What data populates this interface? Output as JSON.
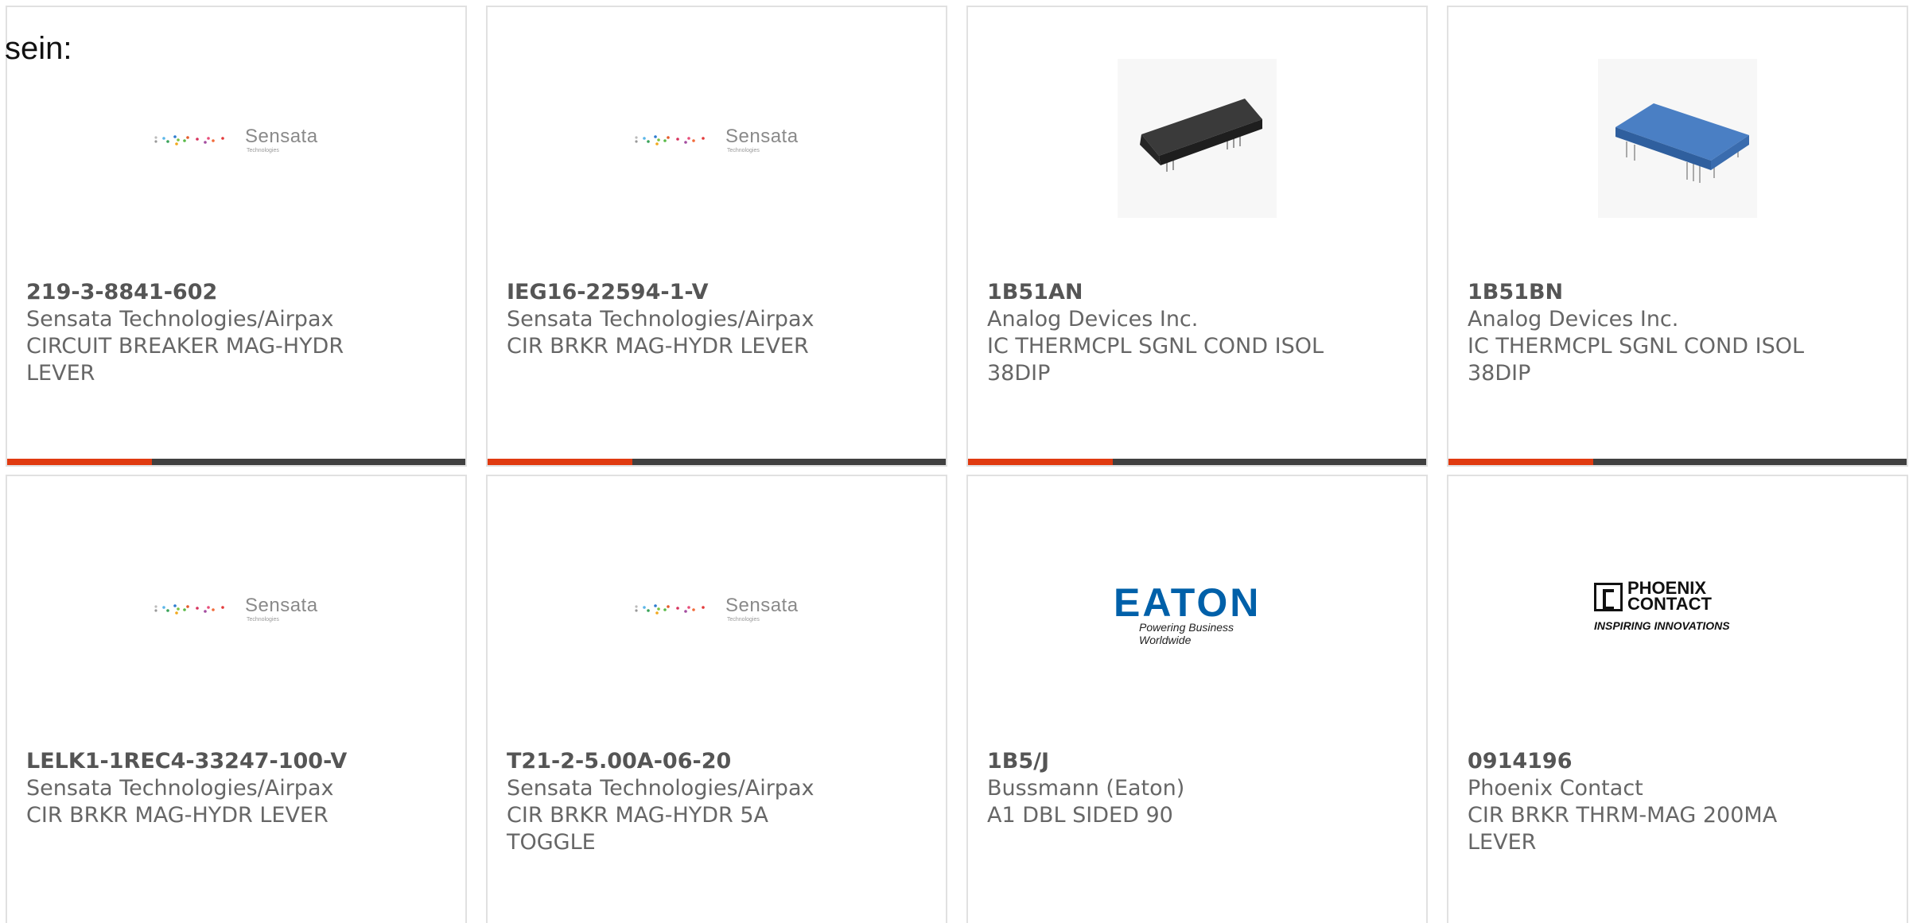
{
  "intro": {
    "text": "sein:"
  },
  "products": [
    {
      "part_number": "219-3-8841-602",
      "manufacturer": "Sensata Technologies/Airpax",
      "description": "CIRCUIT BREAKER MAG-HYDR LEVER",
      "image": "sensata-logo",
      "logo_text": "Sensata",
      "logo_subtext": "Technologies"
    },
    {
      "part_number": "IEG16-22594-1-V",
      "manufacturer": "Sensata Technologies/Airpax",
      "description": "CIR BRKR MAG-HYDR LEVER",
      "image": "sensata-logo",
      "logo_text": "Sensata",
      "logo_subtext": "Technologies"
    },
    {
      "part_number": "1B51AN",
      "manufacturer": "Analog Devices Inc.",
      "description": "IC THERMCPL SGNL COND ISOL 38DIP",
      "image": "black-dip-module",
      "color": "#2a2a2a"
    },
    {
      "part_number": "1B51BN",
      "manufacturer": "Analog Devices Inc.",
      "description": "IC THERMCPL SGNL COND ISOL 38DIP",
      "image": "blue-dip-module",
      "color": "#3f72b8"
    },
    {
      "part_number": "LELK1-1REC4-33247-100-V",
      "manufacturer": "Sensata Technologies/Airpax",
      "description": "CIR BRKR MAG-HYDR LEVER",
      "image": "sensata-logo",
      "logo_text": "Sensata",
      "logo_subtext": "Technologies"
    },
    {
      "part_number": "T21-2-5.00A-06-20",
      "manufacturer": "Sensata Technologies/Airpax",
      "description": "CIR BRKR MAG-HYDR 5A TOGGLE",
      "image": "sensata-logo",
      "logo_text": "Sensata",
      "logo_subtext": "Technologies"
    },
    {
      "part_number": "1B5/J",
      "manufacturer": "Bussmann (Eaton)",
      "description": "A1 DBL SIDED 90",
      "image": "eaton-logo",
      "logo_text": "EATON",
      "logo_subtext": "Powering Business Worldwide"
    },
    {
      "part_number": "0914196",
      "manufacturer": "Phoenix Contact",
      "description": "CIR BRKR THRM-MAG 200MA LEVER",
      "image": "phoenix-contact-logo",
      "logo_text": "PHOENIX",
      "logo_text2": "CONTACT",
      "logo_subtext": "INSPIRING INNOVATIONS"
    }
  ],
  "colors": {
    "accent": "#e03a10",
    "bar": "#404040",
    "border": "#e1e1e1",
    "text": "#666666",
    "eaton_blue": "#0060a9"
  }
}
